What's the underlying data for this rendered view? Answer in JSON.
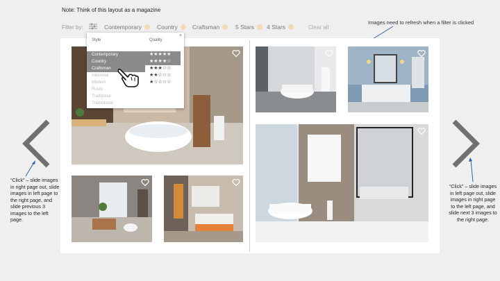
{
  "note": "Note: Think of this layout as a magazine",
  "filter": {
    "label": "Filter by:",
    "icon": "sliders-icon",
    "chips": [
      "Contemporary",
      "Country",
      "Craftsman",
      "5 Stars",
      "4 Stars"
    ],
    "clear_label": "Clear all"
  },
  "annotations": {
    "top_right": "Images need to refresh when a filter is clicked",
    "left": "“Click” – slide images in right page out, slide images in left page to the right page, and slide previous 3 images to the left page.",
    "right": "“Click” – slide images in left page out, slide images in right page to the left page, and slide next 3 images to the right page."
  },
  "dropdown": {
    "close": "×",
    "style_header": "Style",
    "quality_header": "Quality",
    "styles": [
      "Contemporary",
      "Country",
      "Craftsman",
      "Industrial",
      "Modern",
      "Rustic",
      "Traditional",
      "Transitional"
    ],
    "selected_styles": [
      "Contemporary",
      "Country",
      "Craftsman"
    ],
    "quality": [
      "★★★★★",
      "★★★★☆",
      "★★★☆☆",
      "★★☆☆☆",
      "★☆☆☆☆"
    ],
    "selected_quality": [
      "★★★★★",
      "★★★★☆"
    ]
  },
  "photos": [
    "bathroom-photo-1",
    "bathroom-photo-2",
    "bathroom-photo-3",
    "bathroom-photo-4",
    "bathroom-photo-5",
    "bathroom-photo-6"
  ],
  "icons": {
    "favorite": "heart-icon",
    "prev": "chevron-left-icon",
    "next": "chevron-right-icon",
    "cursor": "hand-pointer-icon"
  },
  "colors": {
    "chip_clear": "#f4d9b5",
    "arrow": "#707070",
    "selected_row": "#8a8a8a",
    "callout_arrow": "#2e5fa8"
  }
}
